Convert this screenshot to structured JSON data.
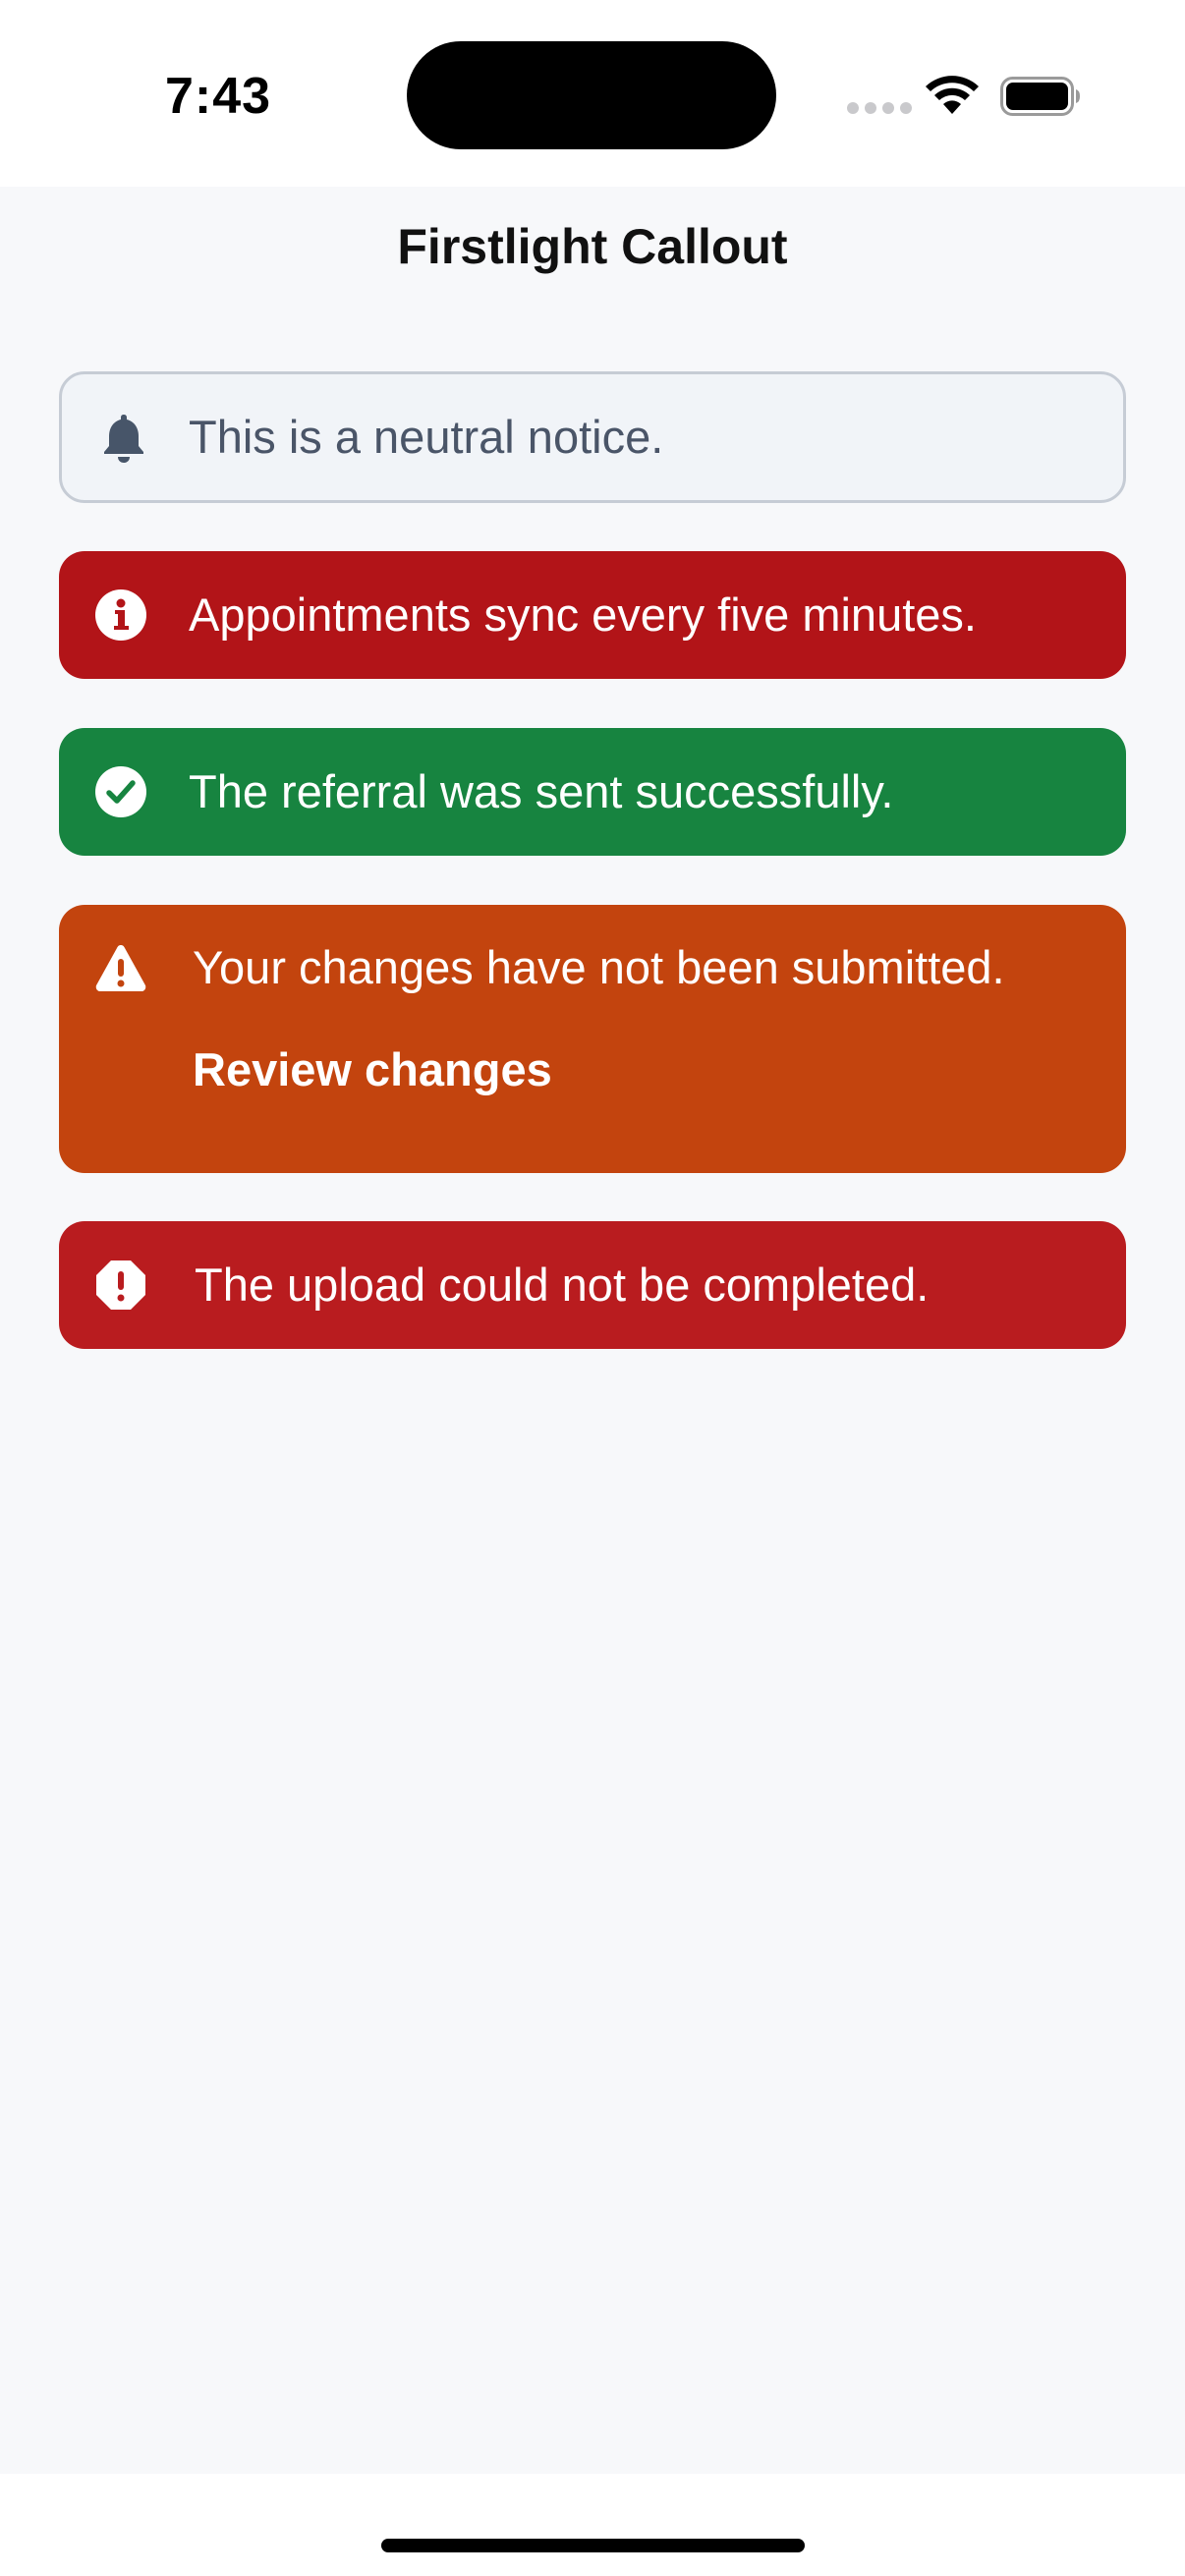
{
  "status_bar": {
    "time": "7:43"
  },
  "nav": {
    "title": "Firstlight Callout"
  },
  "callouts": [
    {
      "kind": "neutral",
      "icon": "bell-icon",
      "text": "This is a neutral notice."
    },
    {
      "kind": "info",
      "icon": "info-circle-icon",
      "text": "Appointments sync every five minutes."
    },
    {
      "kind": "success",
      "icon": "check-circle-icon",
      "text": "The referral was sent successfully."
    },
    {
      "kind": "warning",
      "icon": "warning-triangle-icon",
      "text": "Your changes have not been submitted.",
      "action_label": "Review changes"
    },
    {
      "kind": "error",
      "icon": "error-octagon-icon",
      "text": "The upload could not be completed."
    }
  ],
  "colors": {
    "neutral_bg": "#f1f4f8",
    "neutral_border": "#c6ccd5",
    "neutral_text": "#4a5568",
    "info_bg": "#b21418",
    "success_bg": "#178440",
    "warning_bg": "#c3440e",
    "error_bg": "#b91c1f",
    "page_bg": "#f7f8fa"
  }
}
